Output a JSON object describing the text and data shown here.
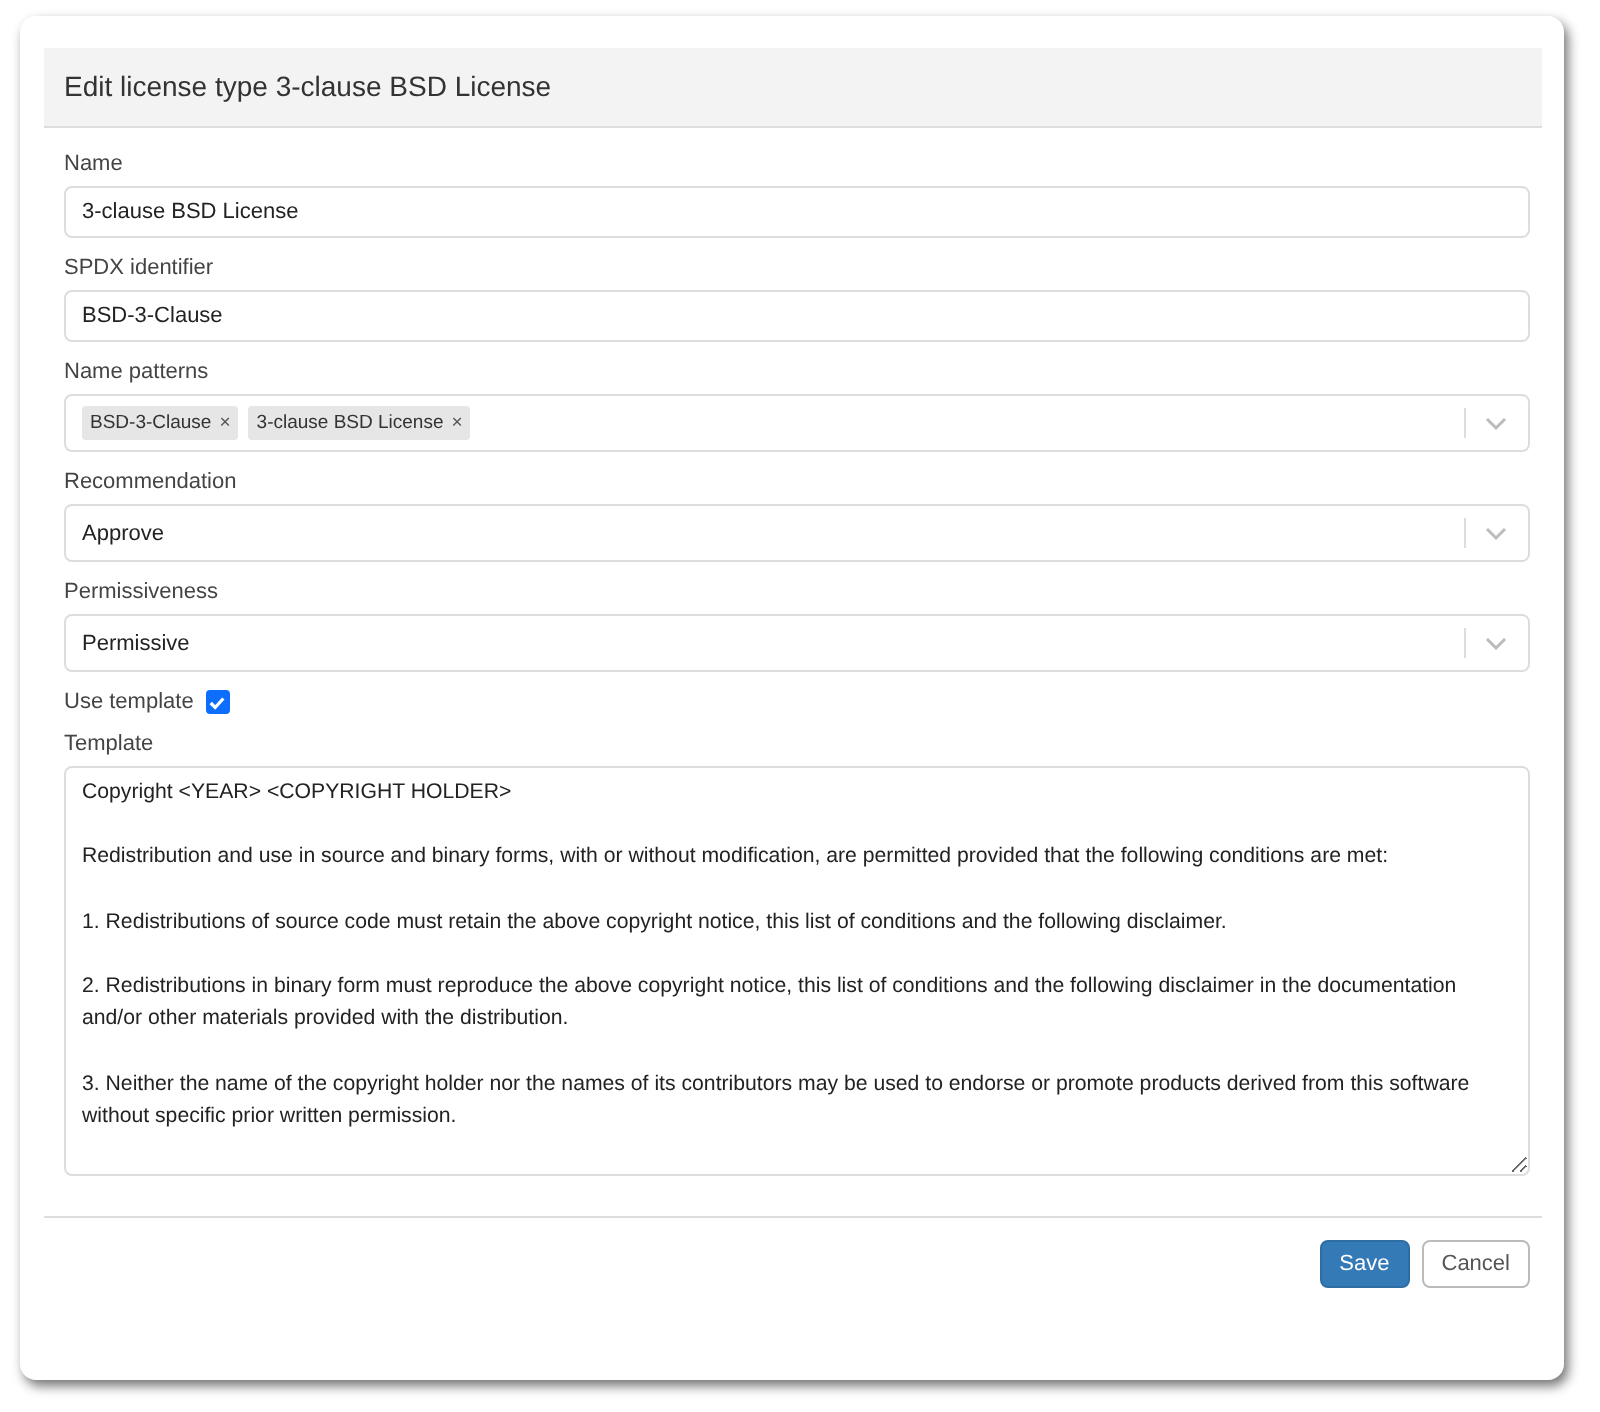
{
  "dialog": {
    "title": "Edit license type 3-clause BSD License"
  },
  "fields": [
    {
      "kind": "text",
      "label": "Name",
      "value": "3-clause BSD License"
    },
    {
      "kind": "text",
      "label": "SPDX identifier",
      "value": "BSD-3-Clause"
    },
    {
      "kind": "tags",
      "label": "Name patterns",
      "tags": [
        {
          "text": "BSD-3-Clause",
          "remove": "×"
        },
        {
          "text": "3-clause BSD License",
          "remove": "×"
        }
      ]
    },
    {
      "kind": "select",
      "label": "Recommendation",
      "value": "Approve"
    },
    {
      "kind": "select",
      "label": "Permissiveness",
      "value": "Permissive"
    },
    {
      "kind": "checkbox",
      "label": "Use template",
      "checked": true
    },
    {
      "kind": "textarea",
      "label": "Template",
      "paragraphs": [
        "Copyright <YEAR> <COPYRIGHT HOLDER>",
        "Redistribution and use in source and binary forms, with or without modification, are permitted provided that the following conditions are met:",
        "1. Redistributions of source code must retain the above copyright notice, this list of conditions and the following disclaimer.",
        "2. Redistributions in binary form must reproduce the above copyright notice, this list of conditions and the following disclaimer in the documentation and/or other materials provided with the distribution.",
        "3. Neither the name of the copyright holder nor the names of its contributors may be used to endorse or promote products derived from this software without specific prior written permission."
      ]
    }
  ],
  "buttons": [
    {
      "kind": "primary",
      "label": "Save"
    },
    {
      "kind": "secondary",
      "label": "Cancel"
    }
  ]
}
